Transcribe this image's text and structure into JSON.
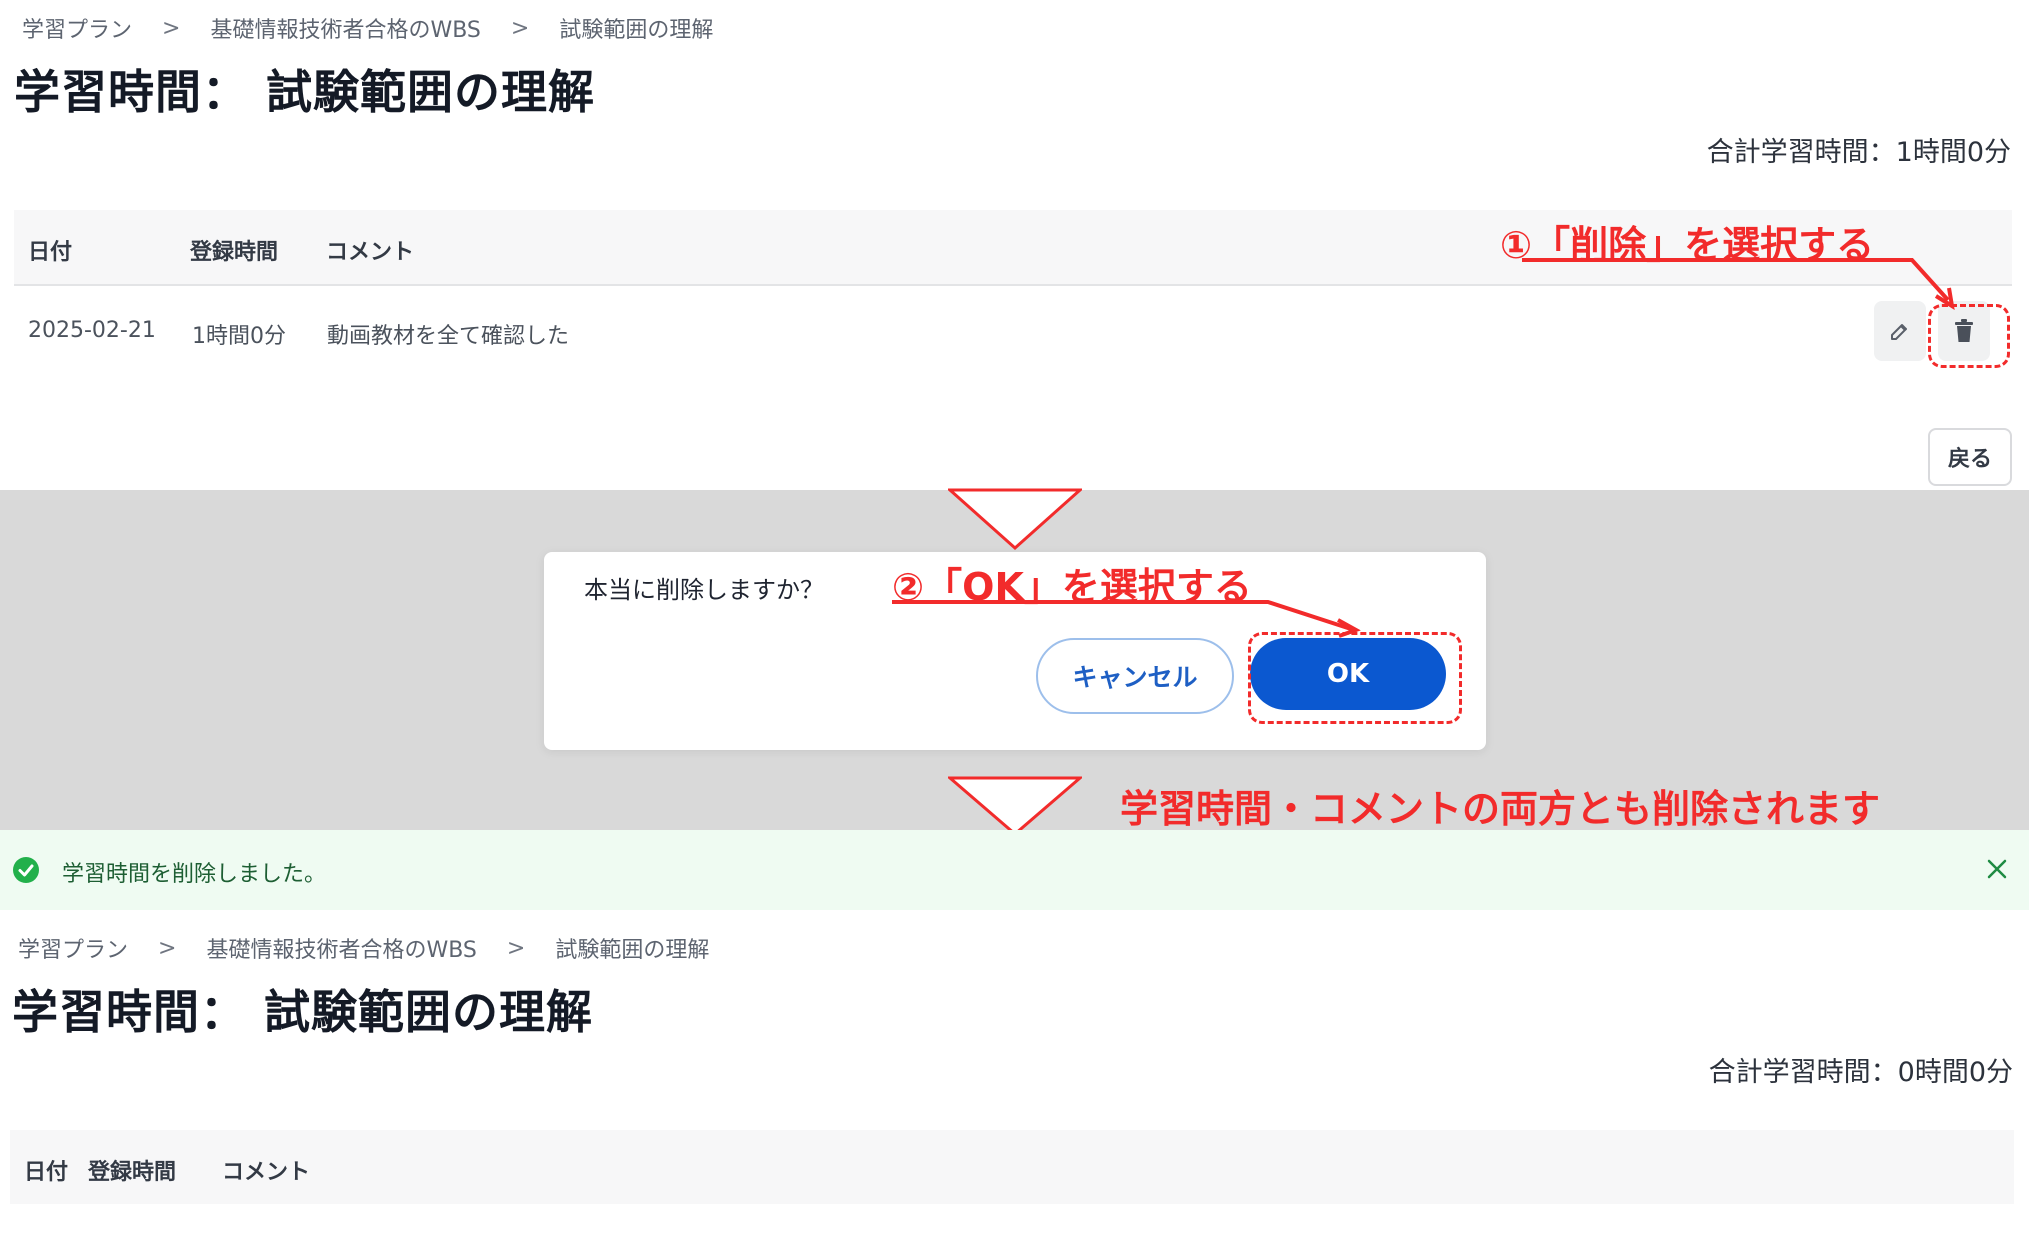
{
  "top": {
    "breadcrumbs": [
      "学習プラン",
      "基礎情報技術者合格のWBS",
      "試験範囲の理解"
    ],
    "separator": ">",
    "title": "学習時間： 試験範囲の理解",
    "total": "合計学習時間：1時間0分",
    "table": {
      "headers": [
        "日付",
        "登録時間",
        "コメント"
      ],
      "rows": [
        {
          "date": "2025-02-21",
          "time": "1時間0分",
          "comment": "動画教材を全て確認した"
        }
      ]
    },
    "back_label": "戻る"
  },
  "annotations": {
    "step1": "①「削除」を選択する",
    "step2": "②「OK」を選択する",
    "result": "学習時間・コメントの両方とも削除されます"
  },
  "dialog": {
    "message": "本当に削除しますか？",
    "cancel_label": "キャンセル",
    "ok_label": "OK"
  },
  "toast": {
    "message": "学習時間を削除しました。"
  },
  "bottom": {
    "breadcrumbs": [
      "学習プラン",
      "基礎情報技術者合格のWBS",
      "試験範囲の理解"
    ],
    "separator": ">",
    "title": "学習時間： 試験範囲の理解",
    "total": "合計学習時間：0時間0分",
    "table": {
      "headers": [
        "日付",
        "登録時間",
        "コメント"
      ]
    }
  },
  "colors": {
    "annotation": "#f22b2b",
    "primary": "#0b58d0",
    "success": "#22b04b"
  }
}
